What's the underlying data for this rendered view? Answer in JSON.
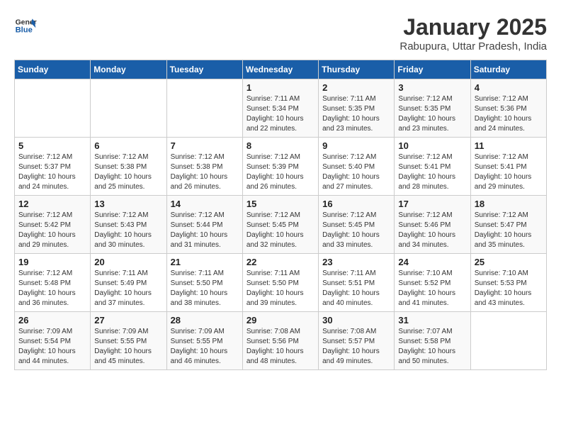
{
  "header": {
    "logo_line1": "General",
    "logo_line2": "Blue",
    "title": "January 2025",
    "subtitle": "Rabupura, Uttar Pradesh, India"
  },
  "weekdays": [
    "Sunday",
    "Monday",
    "Tuesday",
    "Wednesday",
    "Thursday",
    "Friday",
    "Saturday"
  ],
  "weeks": [
    [
      {
        "day": "",
        "info": ""
      },
      {
        "day": "",
        "info": ""
      },
      {
        "day": "",
        "info": ""
      },
      {
        "day": "1",
        "info": "Sunrise: 7:11 AM\nSunset: 5:34 PM\nDaylight: 10 hours\nand 22 minutes."
      },
      {
        "day": "2",
        "info": "Sunrise: 7:11 AM\nSunset: 5:35 PM\nDaylight: 10 hours\nand 23 minutes."
      },
      {
        "day": "3",
        "info": "Sunrise: 7:12 AM\nSunset: 5:35 PM\nDaylight: 10 hours\nand 23 minutes."
      },
      {
        "day": "4",
        "info": "Sunrise: 7:12 AM\nSunset: 5:36 PM\nDaylight: 10 hours\nand 24 minutes."
      }
    ],
    [
      {
        "day": "5",
        "info": "Sunrise: 7:12 AM\nSunset: 5:37 PM\nDaylight: 10 hours\nand 24 minutes."
      },
      {
        "day": "6",
        "info": "Sunrise: 7:12 AM\nSunset: 5:38 PM\nDaylight: 10 hours\nand 25 minutes."
      },
      {
        "day": "7",
        "info": "Sunrise: 7:12 AM\nSunset: 5:38 PM\nDaylight: 10 hours\nand 26 minutes."
      },
      {
        "day": "8",
        "info": "Sunrise: 7:12 AM\nSunset: 5:39 PM\nDaylight: 10 hours\nand 26 minutes."
      },
      {
        "day": "9",
        "info": "Sunrise: 7:12 AM\nSunset: 5:40 PM\nDaylight: 10 hours\nand 27 minutes."
      },
      {
        "day": "10",
        "info": "Sunrise: 7:12 AM\nSunset: 5:41 PM\nDaylight: 10 hours\nand 28 minutes."
      },
      {
        "day": "11",
        "info": "Sunrise: 7:12 AM\nSunset: 5:41 PM\nDaylight: 10 hours\nand 29 minutes."
      }
    ],
    [
      {
        "day": "12",
        "info": "Sunrise: 7:12 AM\nSunset: 5:42 PM\nDaylight: 10 hours\nand 29 minutes."
      },
      {
        "day": "13",
        "info": "Sunrise: 7:12 AM\nSunset: 5:43 PM\nDaylight: 10 hours\nand 30 minutes."
      },
      {
        "day": "14",
        "info": "Sunrise: 7:12 AM\nSunset: 5:44 PM\nDaylight: 10 hours\nand 31 minutes."
      },
      {
        "day": "15",
        "info": "Sunrise: 7:12 AM\nSunset: 5:45 PM\nDaylight: 10 hours\nand 32 minutes."
      },
      {
        "day": "16",
        "info": "Sunrise: 7:12 AM\nSunset: 5:45 PM\nDaylight: 10 hours\nand 33 minutes."
      },
      {
        "day": "17",
        "info": "Sunrise: 7:12 AM\nSunset: 5:46 PM\nDaylight: 10 hours\nand 34 minutes."
      },
      {
        "day": "18",
        "info": "Sunrise: 7:12 AM\nSunset: 5:47 PM\nDaylight: 10 hours\nand 35 minutes."
      }
    ],
    [
      {
        "day": "19",
        "info": "Sunrise: 7:12 AM\nSunset: 5:48 PM\nDaylight: 10 hours\nand 36 minutes."
      },
      {
        "day": "20",
        "info": "Sunrise: 7:11 AM\nSunset: 5:49 PM\nDaylight: 10 hours\nand 37 minutes."
      },
      {
        "day": "21",
        "info": "Sunrise: 7:11 AM\nSunset: 5:50 PM\nDaylight: 10 hours\nand 38 minutes."
      },
      {
        "day": "22",
        "info": "Sunrise: 7:11 AM\nSunset: 5:50 PM\nDaylight: 10 hours\nand 39 minutes."
      },
      {
        "day": "23",
        "info": "Sunrise: 7:11 AM\nSunset: 5:51 PM\nDaylight: 10 hours\nand 40 minutes."
      },
      {
        "day": "24",
        "info": "Sunrise: 7:10 AM\nSunset: 5:52 PM\nDaylight: 10 hours\nand 41 minutes."
      },
      {
        "day": "25",
        "info": "Sunrise: 7:10 AM\nSunset: 5:53 PM\nDaylight: 10 hours\nand 43 minutes."
      }
    ],
    [
      {
        "day": "26",
        "info": "Sunrise: 7:09 AM\nSunset: 5:54 PM\nDaylight: 10 hours\nand 44 minutes."
      },
      {
        "day": "27",
        "info": "Sunrise: 7:09 AM\nSunset: 5:55 PM\nDaylight: 10 hours\nand 45 minutes."
      },
      {
        "day": "28",
        "info": "Sunrise: 7:09 AM\nSunset: 5:55 PM\nDaylight: 10 hours\nand 46 minutes."
      },
      {
        "day": "29",
        "info": "Sunrise: 7:08 AM\nSunset: 5:56 PM\nDaylight: 10 hours\nand 48 minutes."
      },
      {
        "day": "30",
        "info": "Sunrise: 7:08 AM\nSunset: 5:57 PM\nDaylight: 10 hours\nand 49 minutes."
      },
      {
        "day": "31",
        "info": "Sunrise: 7:07 AM\nSunset: 5:58 PM\nDaylight: 10 hours\nand 50 minutes."
      },
      {
        "day": "",
        "info": ""
      }
    ]
  ]
}
